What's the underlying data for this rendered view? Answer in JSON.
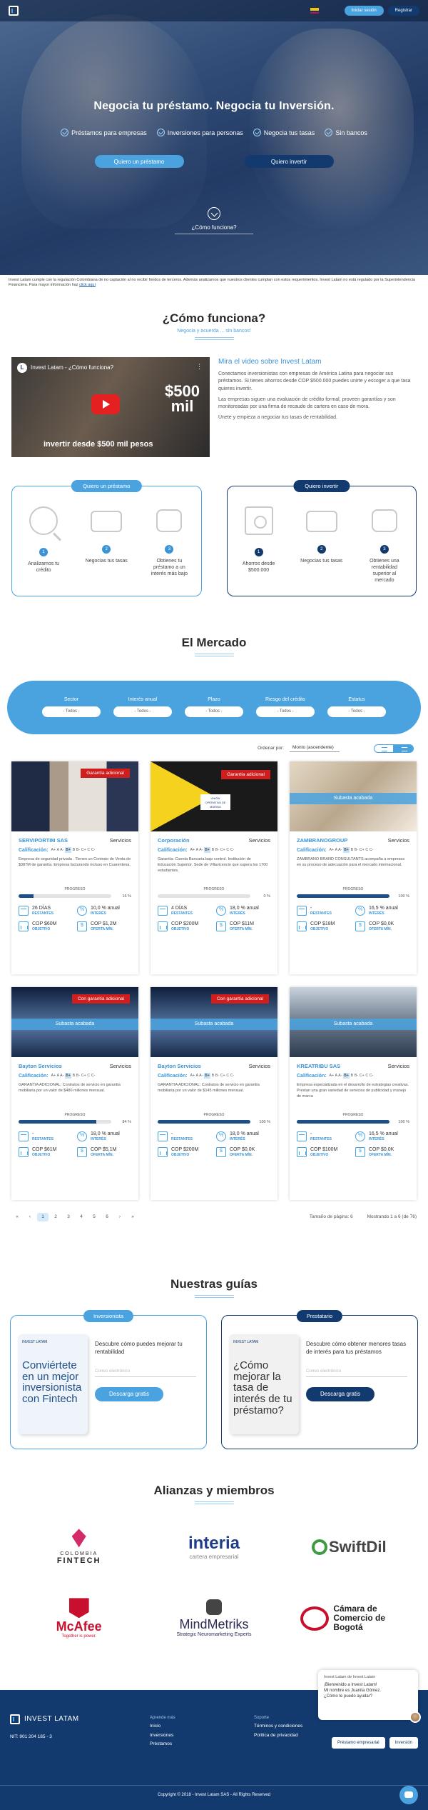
{
  "topbar": {
    "login": "Iniciar sesión",
    "register": "Registrar"
  },
  "hero": {
    "title": "Negocia tu préstamo. Negocia tu Inversión.",
    "checks": [
      "Préstamos para empresas",
      "Inversiones para personas",
      "Negocia tus tasas",
      "Sin bancos"
    ],
    "btn_loan": "Quiero un préstamo",
    "btn_invest": "Quiero invertir",
    "how": "¿Cómo funciona?"
  },
  "regulation": {
    "text": "Invest Latam cumple con la regulación Colombiana de no captación al no recibir fondos de terceros. Además analizamos que nuestros clientes cumplan con estos requerimientos. Invest Latam no está regulado por la Superintendencia Financiera. Para mayor información haz",
    "link": "click aquí"
  },
  "como": {
    "title": "¿Cómo funciona?",
    "subtitle": "Negocia y acuerda ... sin bancos!",
    "video_title": "Invest Latam - ¿Cómo funciona?",
    "video_logo": "L",
    "video_amount": "$500",
    "video_unit": "mil",
    "video_caption": "invertir desde $500 mil pesos",
    "heading": "Mira el video sobre Invest Latam",
    "paragraphs": [
      "Conectamos inversionistas con empresas de América Latina para negociar sus préstamos. Si tienes ahorros desde COP $500.000 puedes unirte y escoger a que tasa quieres invertir.",
      "Las empresas siguen una evaluación de crédito formal, proveen garantías y son monitoreadas por una firma de recaudo de cartera en caso de mora.",
      "Únete y empieza a negociar tus tasas de rentabilidad."
    ],
    "loan_box": {
      "label": "Quiero un préstamo",
      "steps": [
        {
          "n": "1",
          "text": "Analizamos tu crédito"
        },
        {
          "n": "2",
          "text": "Negocias tus tasas"
        },
        {
          "n": "3",
          "text": "Obtienes tu préstamo a un interés más bajo"
        }
      ]
    },
    "invest_box": {
      "label": "Quiero invertir",
      "steps": [
        {
          "n": "1",
          "text": "Ahorros desde $500.000"
        },
        {
          "n": "2",
          "text": "Negocias tus tasas"
        },
        {
          "n": "3",
          "text": "Obtienes una rentabilidad superior al mercado"
        }
      ]
    }
  },
  "mercado": {
    "title": "El Mercado",
    "filters": [
      {
        "label": "Sector",
        "value": "- Todos -"
      },
      {
        "label": "Interés anual",
        "value": "- Todos -"
      },
      {
        "label": "Plazo",
        "value": "- Todos -"
      },
      {
        "label": "Riesgo del crédito",
        "value": "- Todos -"
      },
      {
        "label": "Estatus",
        "value": "- Todos -"
      }
    ],
    "sort_label": "Ordenar por:",
    "sort_value": "Monto (ascendente)",
    "rating_label": "Calificación:",
    "rating_scale": [
      "A+",
      "A",
      "A-",
      "B+",
      "B",
      "B-",
      "C+",
      "C",
      "C-"
    ],
    "progress_label": "PROGRESO",
    "lbl_restantes": "RESTANTES",
    "lbl_interes": "INTERÉS",
    "lbl_objetivo": "OBJETIVO",
    "lbl_oferta": "OFERTA MÍN.",
    "img2_logo": "UNIÓN OPERATIVA DE MARINO",
    "cards": [
      {
        "name": "SERVIPORTIM SAS",
        "sector": "Servicios",
        "rating": "B+",
        "badge": "Garantía adicional",
        "banner": "",
        "desc": "Empresa de seguridad privada . Tienen un Contrato de Venta de $387M de garantía. Empresa facturando incluso en Cuarentena.",
        "progress": 16,
        "progress_text": "16 %",
        "restantes": "26 DÍAS",
        "interes": "10,0 % anual",
        "objetivo": "COP $60M",
        "oferta": "COP $1,2M"
      },
      {
        "name": "Corporación",
        "sector": "Servicios",
        "rating": "B+",
        "badge": "Garantía adicional",
        "banner": "",
        "desc": "Garantía: Cuenta Bancaria bajo control. Institución de Educación Superior. Sede de Villavicencio que supera los 1700 estudiantes.",
        "progress": 0,
        "progress_text": "0 %",
        "restantes": "4 DÍAS",
        "interes": "18,0 % anual",
        "objetivo": "COP $200M",
        "oferta": "COP $11M"
      },
      {
        "name": "ZAMBRANOGROUP",
        "sector": "Servicios",
        "rating": "B+",
        "badge": "",
        "banner": "Subasta acabada",
        "desc": "ZAMBRANO BRAND CONSULTANTS acompaña a empresas en su proceso de adecuación para el mercado internacional.",
        "progress": 100,
        "progress_text": "100 %",
        "restantes": "-",
        "interes": "16,5 % anual",
        "objetivo": "COP $18M",
        "oferta": "COP $0,0K"
      },
      {
        "name": "Bayton Servicios",
        "sector": "Servicios",
        "rating": "B+",
        "badge": "Con garantía adicional",
        "banner": "Subasta acabada",
        "desc": "GARANTÍA ADICIONAL: Contratos de servicio en garantía mobiliaria por un valor de $480 millones mensual.",
        "progress": 84,
        "progress_text": "84 %",
        "restantes": "-",
        "interes": "18,0 % anual",
        "objetivo": "COP $61M",
        "oferta": "COP $5,1M"
      },
      {
        "name": "Bayton Servicios",
        "sector": "Servicios",
        "rating": "B+",
        "badge": "Con garantía adicional",
        "banner": "Subasta acabada",
        "desc": "GARANTÍA ADICIONAL: Contratos de servicio en garantía mobiliaria por un valor de $145 millones mensual.",
        "progress": 100,
        "progress_text": "100 %",
        "restantes": "-",
        "interes": "18,0 % anual",
        "objetivo": "COP $200M",
        "oferta": "COP $0,0K"
      },
      {
        "name": "KREATRIBU SAS",
        "sector": "Servicios",
        "rating": "B+",
        "badge": "",
        "banner": "Subasta acabada",
        "desc": "Empresa especializada en el desarrollo de estrategias creativas. Prestan una gran variedad de servicios de publicidad y manejo de marca",
        "progress": 100,
        "progress_text": "100 %",
        "restantes": "-",
        "interes": "16,5 % anual",
        "objetivo": "COP $100M",
        "oferta": "COP $0,0K"
      }
    ],
    "pager": [
      "«",
      "‹",
      "1",
      "2",
      "3",
      "4",
      "5",
      "6",
      "›",
      "»"
    ],
    "pager_active": "1",
    "page_size_label": "Tamaño de página:",
    "page_size": "6",
    "showing": "Mostrando 1 a 6 (de 76)"
  },
  "guias": {
    "title": "Nuestras guías",
    "investor": {
      "label": "Inversionista",
      "logo": "INVEST LATAM",
      "book": "Conviértete en un mejor inversionista con Fintech",
      "text": "Descubre cómo puedes mejorar tu rentabilidad",
      "placeholder": "Correo electrónico",
      "btn": "Descarga gratis"
    },
    "borrower": {
      "label": "Prestatario",
      "logo": "INVEST LATAM",
      "book": "¿Cómo mejorar la tasa de interés de tu préstamo?",
      "text": "Descubre cómo obtener menores tasas de interés para tus préstamos",
      "placeholder": "Correo electrónico",
      "btn": "Descarga gratis"
    }
  },
  "alianzas": {
    "title": "Alianzas y miembros",
    "colombia": [
      "COLOMBIA",
      "FINTECH"
    ],
    "interia": [
      "interia",
      "cartera empresarial"
    ],
    "swift": "SwiftDil",
    "mcafee": [
      "McAfee",
      "Together is power."
    ],
    "mind": [
      "MindMetriks",
      "Strategic Neuromarketing Experts"
    ],
    "camara": "Cámara de Comercio de Bogotá"
  },
  "footer": {
    "brand": "INVEST LATAM",
    "nit": "NIT: 901 204 185 - 3",
    "col1_head": "Aprende más",
    "col1": [
      "Inicio",
      "Inversiones",
      "Préstamos"
    ],
    "col2_head": "Soporte",
    "col2": [
      "Términos y condiciones",
      "Política de privacidad"
    ],
    "chat_head": "Invest Latam de Invest Latam",
    "chat_lines": [
      "¡Bienvenido a Invest Latam!",
      "Mi nombre es Juanita Gómez.",
      "¿Cómo te puedo ayudar?"
    ],
    "btn_loan": "Préstamo empresarial",
    "btn_invest": "Inversión",
    "copyright": "Copyright © 2018 - Invest Latam SAS - All Rights Reserved"
  },
  "colors": {
    "primary": "#4aa3df",
    "dark": "#123a6e",
    "badge": "#d01d1d"
  }
}
